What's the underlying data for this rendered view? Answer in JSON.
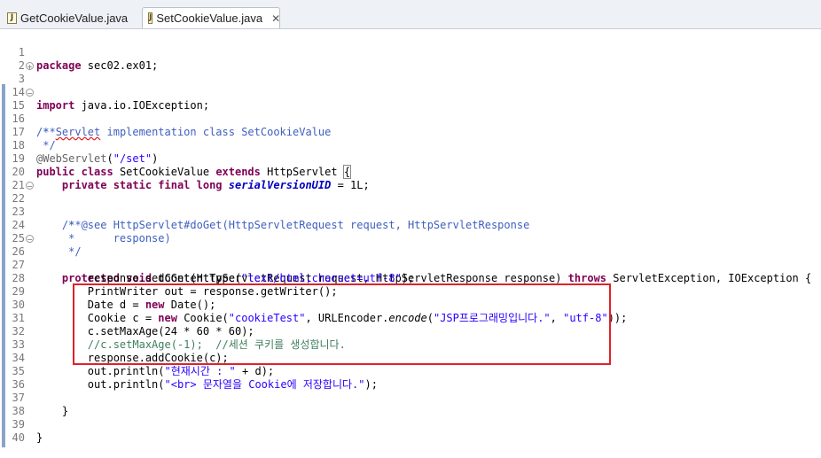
{
  "tabs": [
    {
      "label": "GetCookieValue.java",
      "active": false
    },
    {
      "label": "SetCookieValue.java",
      "active": true
    }
  ],
  "line_numbers": [
    "1",
    "2",
    "3",
    "14",
    "15",
    "16",
    "17",
    "18",
    "19",
    "20",
    "21",
    "22",
    "23",
    "24",
    "25",
    "26",
    "27",
    "28",
    "29",
    "30",
    "31",
    "32",
    "33",
    "34",
    "35",
    "36",
    "37",
    "38",
    "39",
    "40"
  ],
  "code": {
    "l1_kw": "package",
    "l1_rest": " sec02.ex01;",
    "l3_kw": "import",
    "l3_rest": " java.io.IOException;",
    "l15": "/**",
    "l16": " * Servlet implementation class SetCookieValue",
    "l16_squig": "Servlet",
    "l17": " */",
    "l18_ann": "@WebServlet",
    "l18_rest": "(",
    "l18_str": "\"/set\"",
    "l18_end": ")",
    "l19_kw1": "public",
    "l19_kw2": "class",
    "l19_name": " SetCookieValue ",
    "l19_kw3": "extends",
    "l19_rest": " HttpServlet ",
    "l19_brace": "{",
    "l20_kw": "private static final long",
    "l20_fld": "serialVersionUID",
    "l20_rest": " = 1L;",
    "l22": "/**",
    "l23": " * @see HttpServlet#doGet(HttpServletRequest request, HttpServletResponse",
    "l24": " *      response)",
    "l25": " */",
    "l26_kw": "protected void",
    "l26_rest": " doGet(HttpServletRequest request, HttpServletResponse response) ",
    "l26_kw2": "throws",
    "l26_end": " ServletException, IOException {",
    "l27_rest": "response.setContentType(",
    "l27_str": "\"text/html;charset=utf-8\"",
    "l27_end": ");",
    "l28": "PrintWriter out = response.getWriter();",
    "l29_a": "Date d = ",
    "l29_kw": "new",
    "l29_b": " Date();",
    "l30_a": "Cookie c = ",
    "l30_kw": "new",
    "l30_b": " Cookie(",
    "l30_str1": "\"cookieTest\"",
    "l30_c": ", URLEncoder.",
    "l30_ital": "encode",
    "l30_d": "(",
    "l30_str2": "\"JSP프로그래밍입니다.\"",
    "l30_e": ", ",
    "l30_str3": "\"utf-8\"",
    "l30_f": "));",
    "l31": "c.setMaxAge(24 * 60 * 60);",
    "l32": "//c.setMaxAge(-1);  //세션 쿠키를 생성합니다.",
    "l33": "response.addCookie(c);",
    "l34_a": "out.println(",
    "l34_str": "\"현재시간 : \"",
    "l34_b": " + d);",
    "l35_a": "out.println(",
    "l35_str": "\"<br> 문자열을 Cookie에 저장합니다.\"",
    "l35_b": ");",
    "l37": "}",
    "l39": "}"
  }
}
